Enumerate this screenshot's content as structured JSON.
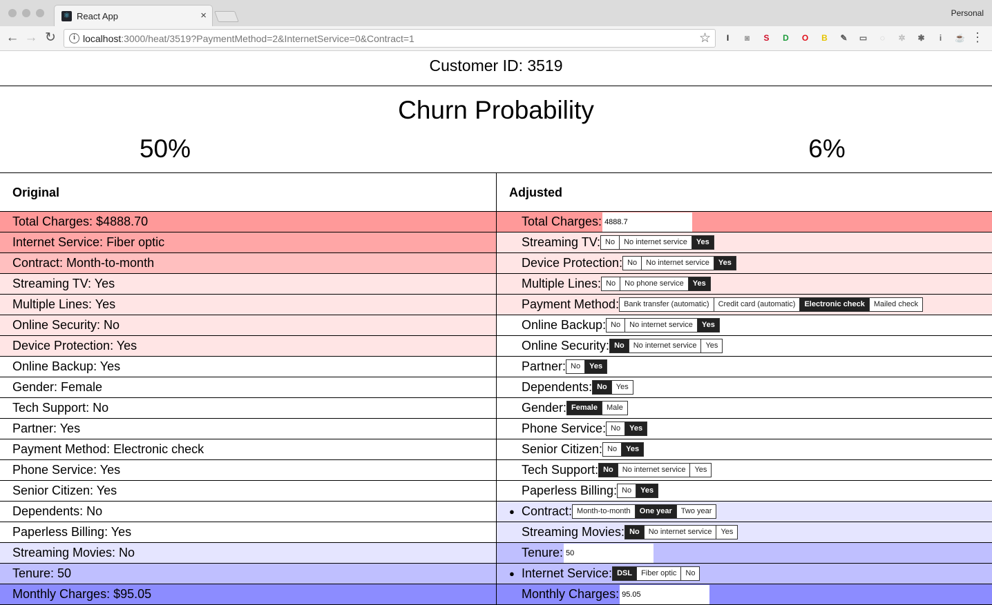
{
  "browser": {
    "tab_title": "React App",
    "tab_close": "×",
    "profile": "Personal",
    "url_host": "localhost",
    "url_rest": ":3000/heat/3519?PaymentMethod=2&InternetService=0&Contract=1",
    "nav": {
      "back": "←",
      "forward": "→",
      "reload": "↻"
    },
    "star": "☆",
    "menu": "⋮",
    "extensions": [
      {
        "name": "instapaper-icon",
        "glyph": "I",
        "color": "#222"
      },
      {
        "name": "camera-icon",
        "glyph": "◙",
        "color": "#999"
      },
      {
        "name": "s-extension-icon",
        "glyph": "S",
        "color": "#d0102a"
      },
      {
        "name": "green-extension-icon",
        "glyph": "D",
        "color": "#1e9c3b"
      },
      {
        "name": "opera-icon",
        "glyph": "O",
        "color": "#e0101b"
      },
      {
        "name": "b-extension-icon",
        "glyph": "B",
        "color": "#e6c400"
      },
      {
        "name": "pin-icon",
        "glyph": "✎",
        "color": "#555"
      },
      {
        "name": "cast-icon",
        "glyph": "▭",
        "color": "#666"
      },
      {
        "name": "circle-extension-icon",
        "glyph": "◌",
        "color": "#bbb"
      },
      {
        "name": "gear-extension-icon",
        "glyph": "✲",
        "color": "#bbb"
      },
      {
        "name": "bug-icon",
        "glyph": "✱",
        "color": "#666"
      },
      {
        "name": "info-extension-icon",
        "glyph": "i",
        "color": "#666"
      },
      {
        "name": "cup-extension-icon",
        "glyph": "☕",
        "color": "#555"
      }
    ]
  },
  "header": {
    "customer_id": "Customer ID: 3519",
    "title": "Churn Probability",
    "original_prob": "50%",
    "adjusted_prob": "6%"
  },
  "columns": {
    "original": "Original",
    "adjusted": "Adjusted"
  },
  "colors": {
    "red_strong": "#ff9999",
    "red_medium": "#ffbfbf",
    "red_light": "#ffe5e5",
    "blue_light": "#e5e5ff",
    "blue_medium": "#bfbfff",
    "blue_strong": "#9999ff",
    "white": "#ffffff"
  },
  "original_rows": [
    {
      "text": "Total Charges: $4888.70",
      "color": "#ff9999"
    },
    {
      "text": "Internet Service: Fiber optic",
      "color": "#ffa6a6"
    },
    {
      "text": "Contract: Month-to-month",
      "color": "#ffbfbf"
    },
    {
      "text": "Streaming TV: Yes",
      "color": "#ffe5e5"
    },
    {
      "text": "Multiple Lines: Yes",
      "color": "#ffe5e5"
    },
    {
      "text": "Online Security: No",
      "color": "#ffe5e5"
    },
    {
      "text": "Device Protection: Yes",
      "color": "#ffe5e5"
    },
    {
      "text": "Online Backup: Yes",
      "color": "#ffffff"
    },
    {
      "text": "Gender: Female",
      "color": "#ffffff"
    },
    {
      "text": "Tech Support: No",
      "color": "#ffffff"
    },
    {
      "text": "Partner: Yes",
      "color": "#ffffff"
    },
    {
      "text": "Payment Method: Electronic check",
      "color": "#ffffff"
    },
    {
      "text": "Phone Service: Yes",
      "color": "#ffffff"
    },
    {
      "text": "Senior Citizen: Yes",
      "color": "#ffffff"
    },
    {
      "text": "Dependents: No",
      "color": "#ffffff"
    },
    {
      "text": "Paperless Billing: Yes",
      "color": "#ffffff"
    },
    {
      "text": "Streaming Movies: No",
      "color": "#e5e5ff"
    },
    {
      "text": "Tenure: 50",
      "color": "#bfbfff"
    },
    {
      "text": "Monthly Charges: $95.05",
      "color": "#8c8cff"
    }
  ],
  "adjusted_rows": [
    {
      "label": "Total Charges:",
      "color": "#ff9999",
      "input": "4888.7"
    },
    {
      "label": "Streaming TV:",
      "color": "#ffe5e5",
      "options": [
        "No",
        "No internet service",
        "Yes"
      ],
      "selected": 2
    },
    {
      "label": "Device Protection:",
      "color": "#ffe5e5",
      "options": [
        "No",
        "No internet service",
        "Yes"
      ],
      "selected": 2
    },
    {
      "label": "Multiple Lines:",
      "color": "#ffe5e5",
      "options": [
        "No",
        "No phone service",
        "Yes"
      ],
      "selected": 2
    },
    {
      "label": "Payment Method:",
      "color": "#ffe5e5",
      "options": [
        "Bank transfer (automatic)",
        "Credit card (automatic)",
        "Electronic check",
        "Mailed check"
      ],
      "selected": 2
    },
    {
      "label": "Online Backup:",
      "color": "#ffffff",
      "options": [
        "No",
        "No internet service",
        "Yes"
      ],
      "selected": 2
    },
    {
      "label": "Online Security:",
      "color": "#ffffff",
      "options": [
        "No",
        "No internet service",
        "Yes"
      ],
      "selected": 0
    },
    {
      "label": "Partner:",
      "color": "#ffffff",
      "options": [
        "No",
        "Yes"
      ],
      "selected": 1
    },
    {
      "label": "Dependents:",
      "color": "#ffffff",
      "options": [
        "No",
        "Yes"
      ],
      "selected": 0
    },
    {
      "label": "Gender:",
      "color": "#ffffff",
      "options": [
        "Female",
        "Male"
      ],
      "selected": 0
    },
    {
      "label": "Phone Service:",
      "color": "#ffffff",
      "options": [
        "No",
        "Yes"
      ],
      "selected": 1
    },
    {
      "label": "Senior Citizen:",
      "color": "#ffffff",
      "options": [
        "No",
        "Yes"
      ],
      "selected": 1
    },
    {
      "label": "Tech Support:",
      "color": "#ffffff",
      "options": [
        "No",
        "No internet service",
        "Yes"
      ],
      "selected": 0
    },
    {
      "label": "Paperless Billing:",
      "color": "#ffffff",
      "options": [
        "No",
        "Yes"
      ],
      "selected": 1
    },
    {
      "label": "Contract:",
      "color": "#e5e5ff",
      "bullet": "●",
      "options": [
        "Month-to-month",
        "One year",
        "Two year"
      ],
      "selected": 1
    },
    {
      "label": "Streaming Movies:",
      "color": "#e5e5ff",
      "options": [
        "No",
        "No internet service",
        "Yes"
      ],
      "selected": 0
    },
    {
      "label": "Tenure:",
      "color": "#bfbfff",
      "input": "50"
    },
    {
      "label": "Internet Service:",
      "color": "#bfbfff",
      "bullet": "●",
      "options": [
        "DSL",
        "Fiber optic",
        "No"
      ],
      "selected": 0
    },
    {
      "label": "Monthly Charges:",
      "color": "#8c8cff",
      "input": "95.05"
    }
  ]
}
